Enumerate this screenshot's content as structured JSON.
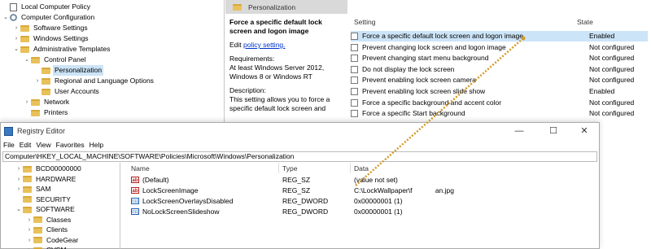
{
  "gp": {
    "tree": [
      {
        "label": "Local Computer Policy",
        "indent": 0,
        "chev": "",
        "icon": "doc"
      },
      {
        "label": "Computer Configuration",
        "indent": 0,
        "chev": "⌄",
        "icon": "gear"
      },
      {
        "label": "Software Settings",
        "indent": 1,
        "chev": "›",
        "icon": "folder"
      },
      {
        "label": "Windows Settings",
        "indent": 1,
        "chev": "›",
        "icon": "folder"
      },
      {
        "label": "Administrative Templates",
        "indent": 1,
        "chev": "⌄",
        "icon": "folder"
      },
      {
        "label": "Control Panel",
        "indent": 2,
        "chev": "⌄",
        "icon": "folder"
      },
      {
        "label": "Personalization",
        "indent": 3,
        "chev": "",
        "icon": "folder",
        "selected": true
      },
      {
        "label": "Regional and Language Options",
        "indent": 3,
        "chev": "›",
        "icon": "folder"
      },
      {
        "label": "User Accounts",
        "indent": 3,
        "chev": "",
        "icon": "folder"
      },
      {
        "label": "Network",
        "indent": 2,
        "chev": "›",
        "icon": "folder"
      },
      {
        "label": "Printers",
        "indent": 2,
        "chev": "",
        "icon": "folder"
      }
    ],
    "header": "Personalization",
    "desc": {
      "title": "Force a specific default lock screen and logon image",
      "edit_prefix": "Edit ",
      "edit_link": "policy setting.",
      "req_label": "Requirements:",
      "req_text": "At least Windows Server 2012, Windows 8 or Windows RT",
      "desc_label": "Description:",
      "desc_text": "This setting allows you to force a specific default lock screen and"
    },
    "list": {
      "col_setting": "Setting",
      "col_state": "State",
      "rows": [
        {
          "name": "Force a specific default lock screen and logon image",
          "state": "Enabled",
          "selected": true
        },
        {
          "name": "Prevent changing lock screen and logon image",
          "state": "Not configured"
        },
        {
          "name": "Prevent changing start menu background",
          "state": "Not configured"
        },
        {
          "name": "Do not display the lock screen",
          "state": "Not configured"
        },
        {
          "name": "Prevent enabling lock screen camera",
          "state": "Not configured"
        },
        {
          "name": "Prevent enabling lock screen slide show",
          "state": "Enabled"
        },
        {
          "name": "Force a specific background and accent color",
          "state": "Not configured"
        },
        {
          "name": "Force a specific Start background",
          "state": "Not configured"
        }
      ]
    }
  },
  "reg": {
    "title": "Registry Editor",
    "menu": [
      "File",
      "Edit",
      "View",
      "Favorites",
      "Help"
    ],
    "address": "Computer\\HKEY_LOCAL_MACHINE\\SOFTWARE\\Policies\\Microsoft\\Windows\\Personalization",
    "tree": [
      {
        "label": "BCD00000000",
        "indent": 1,
        "chev": "›"
      },
      {
        "label": "HARDWARE",
        "indent": 1,
        "chev": "›"
      },
      {
        "label": "SAM",
        "indent": 1,
        "chev": "›"
      },
      {
        "label": "SECURITY",
        "indent": 1,
        "chev": ""
      },
      {
        "label": "SOFTWARE",
        "indent": 1,
        "chev": "⌄"
      },
      {
        "label": "Classes",
        "indent": 2,
        "chev": "›"
      },
      {
        "label": "Clients",
        "indent": 2,
        "chev": "›"
      },
      {
        "label": "CodeGear",
        "indent": 2,
        "chev": "›"
      },
      {
        "label": "CVSM",
        "indent": 2,
        "chev": "›"
      }
    ],
    "columns": {
      "name": "Name",
      "type": "Type",
      "data": "Data"
    },
    "values": [
      {
        "name": "(Default)",
        "type": "REG_SZ",
        "data": "(value not set)",
        "icon": "ab"
      },
      {
        "name": "LockScreenImage",
        "type": "REG_SZ",
        "data": "C:\\LockWallpaper\\f            an.jpg",
        "icon": "ab"
      },
      {
        "name": "LockScreenOverlaysDisabled",
        "type": "REG_DWORD",
        "data": "0x00000001 (1)",
        "icon": "bin"
      },
      {
        "name": "NoLockScreenSlideshow",
        "type": "REG_DWORD",
        "data": "0x00000001 (1)",
        "icon": "bin"
      }
    ],
    "window_buttons": {
      "minimize": "—",
      "maximize": "☐",
      "close": "✕"
    }
  },
  "accent_colors": {
    "selection": "#cce4f7",
    "folder": "#e8c15a",
    "annotation": "#d19a2a"
  }
}
